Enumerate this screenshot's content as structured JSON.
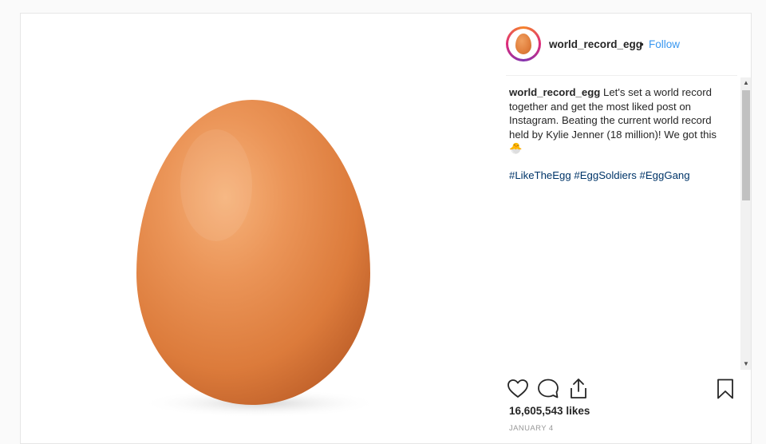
{
  "post": {
    "username": "world_record_egg",
    "separator": "•",
    "follow_label": "Follow",
    "caption": {
      "username": "world_record_egg",
      "text": "Let's set a world record together and get the most liked post on Instagram. Beating the current world record held by Kylie Jenner (18 million)! We got this",
      "emoji": "🐣"
    },
    "hashtags": [
      "#LikeTheEgg",
      "#EggSoldiers",
      "#EggGang"
    ],
    "likes": "16,605,543 likes",
    "date": "JANUARY 4"
  },
  "icons": {
    "like": "heart-icon",
    "comment": "comment-icon",
    "share": "share-icon",
    "save": "bookmark-icon"
  },
  "colors": {
    "link": "#3897f0",
    "hashtag": "#003569",
    "text": "#262626"
  }
}
